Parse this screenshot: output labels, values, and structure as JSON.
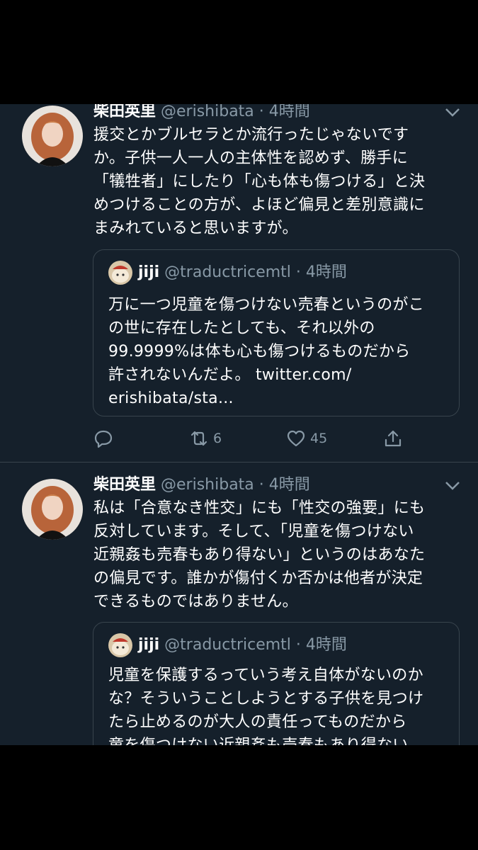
{
  "tweets": [
    {
      "name": "柴田英里",
      "handle": "@erishibata",
      "time": "· 4時間",
      "lines": [
        "援交とかブルセラとか流行ったじゃないです",
        "か。子供一人一人の主体性を認めず、勝手に",
        "「犠牲者」にしたり「心も体も傷つける」と決",
        "めつけることの方が、よほど偏見と差別意識に",
        "まみれていると思いますが。"
      ],
      "quote": {
        "name": "jiji",
        "handle": "@traductricemtl",
        "time": "· 4時間",
        "lines": [
          "万に一つ児童を傷つけない売春というのがこ",
          "の世に存在したとしても、それ以外の",
          "99.9999%は体も心も傷つけるものだから",
          "許されないんだよ。 twitter.com/",
          "erishibata/sta..."
        ]
      },
      "actions": {
        "reply_icon": "reply-icon",
        "retweet_icon": "retweet-icon",
        "retweet_count": "6",
        "like_icon": "heart-icon",
        "like_count": "45",
        "share_icon": "share-icon"
      }
    },
    {
      "name": "柴田英里",
      "handle": "@erishibata",
      "time": "· 4時間",
      "lines": [
        "私は「合意なき性交」にも「性交の強要」にも",
        "反対しています。そして、「児童を傷つけない",
        "近親姦も売春もあり得ない」というのはあなた",
        "の偏見です。誰かが傷付くか否かは他者が決定",
        "できるものではありません。"
      ],
      "quote": {
        "name": "jiji",
        "handle": "@traductricemtl",
        "time": "· 4時間",
        "lines": [
          "児童を保護するっていう考え自体がないのか",
          "な？そういうことしようとする子供を見つけ",
          "たら止めるのが大人の責任ってものだから",
          "童を傷つけない近親姦も売春もあり得ない"
        ]
      }
    }
  ],
  "compose_button": {
    "icon": "compose-feather-icon"
  },
  "colors": {
    "background": "#15202b",
    "border": "#38444d",
    "secondary_text": "#8899a6",
    "accent": "#1da1f2"
  }
}
